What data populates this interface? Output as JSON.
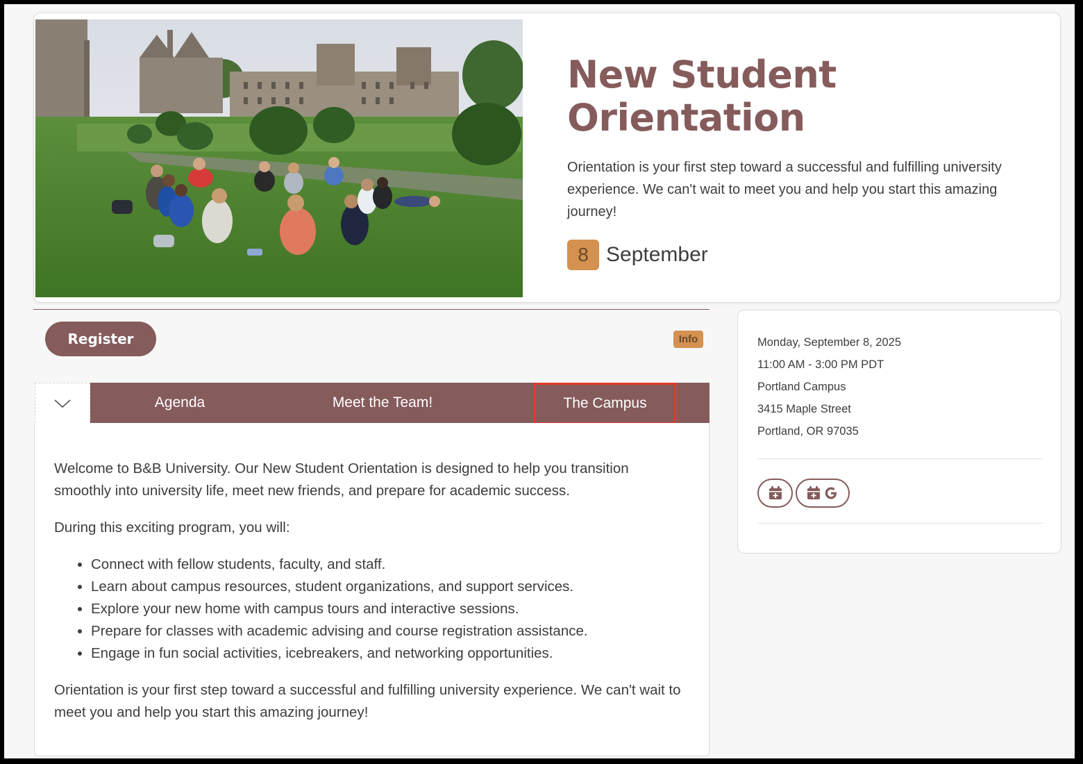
{
  "hero": {
    "title_line1": "New Student",
    "title_line2": "Orientation",
    "description": "Orientation is your first step toward a successful and fulfilling university experience. We can't wait to meet you and help you start this amazing journey!",
    "date_day": "8",
    "date_month": "September"
  },
  "actions": {
    "register_label": "Register",
    "info_badge": "Info"
  },
  "tabs": [
    {
      "label": "Agenda"
    },
    {
      "label": "Meet the Team!"
    },
    {
      "label": "The Campus"
    }
  ],
  "content": {
    "intro": "Welcome to B&B University. Our New Student Orientation is designed to help you transition smoothly into university life, meet new friends, and prepare for academic success.",
    "lead": "During this exciting program, you will:",
    "bullets": [
      "Connect with fellow students, faculty, and staff.",
      "Learn about campus resources, student organizations, and support services.",
      "Explore your new home with campus tours and interactive sessions.",
      "Prepare for classes with academic advising and course registration assistance.",
      "Engage in fun social activities, icebreakers, and networking opportunities."
    ],
    "closing": "Orientation is your first step toward a successful and fulfilling university experience. We can't wait to meet you and help you start this amazing journey!"
  },
  "event_details": {
    "date": "Monday, September 8, 2025",
    "time": "11:00 AM - 3:00 PM PDT",
    "location": "Portland Campus",
    "street": "3415 Maple Street",
    "city": "Portland, OR 97035"
  },
  "colors": {
    "brand": "#855b5b",
    "accent": "#d4914f",
    "highlight_border": "#e03a27"
  },
  "icons": {
    "add_to_calendar": "calendar-plus-icon",
    "add_to_google_calendar": "google-icon",
    "collapse_toggle": "chevron-down-icon"
  }
}
